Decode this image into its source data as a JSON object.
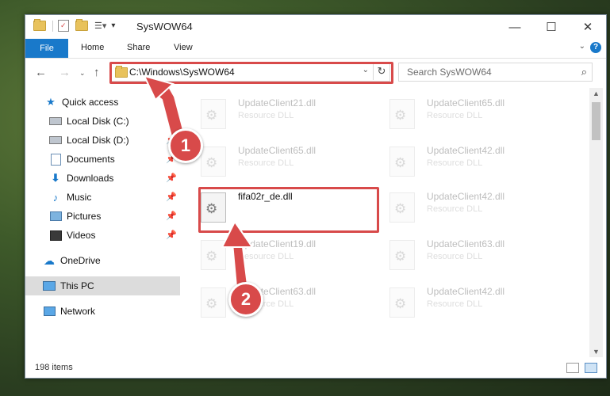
{
  "window": {
    "title": "SysWOW64",
    "minimize": "—",
    "maximize": "☐",
    "close": "✕"
  },
  "ribbon": {
    "tabs": [
      "File",
      "Home",
      "Share",
      "View"
    ],
    "help": "?"
  },
  "navbar": {
    "address": "C:\\Windows\\SysWOW64",
    "search_placeholder": "Search SysWOW64"
  },
  "sidebar": {
    "items": [
      {
        "label": "Quick access",
        "icon": "star-icon",
        "pinned": false
      },
      {
        "label": "Local Disk (C:)",
        "icon": "drive-icon",
        "pinned": false
      },
      {
        "label": "Local Disk (D:)",
        "icon": "drive-icon",
        "pinned": true
      },
      {
        "label": "Documents",
        "icon": "documents-icon",
        "pinned": true
      },
      {
        "label": "Downloads",
        "icon": "download-icon",
        "pinned": true
      },
      {
        "label": "Music",
        "icon": "music-icon",
        "pinned": true
      },
      {
        "label": "Pictures",
        "icon": "pictures-icon",
        "pinned": true
      },
      {
        "label": "Videos",
        "icon": "videos-icon",
        "pinned": true
      },
      {
        "label": "OneDrive",
        "icon": "cloud-icon",
        "pinned": false
      },
      {
        "label": "This PC",
        "icon": "computer-icon",
        "pinned": false,
        "selected": true
      },
      {
        "label": "Network",
        "icon": "network-icon",
        "pinned": false
      }
    ]
  },
  "files": {
    "left": [
      {
        "name": "UpdateClient21.dll",
        "type": "Resource DLL"
      },
      {
        "name": "UpdateClient65.dll",
        "type": "Resource DLL"
      },
      {
        "name": "fifa02r_de.dll",
        "type": ""
      },
      {
        "name": "UpdateClient19.dll",
        "type": "Resource DLL"
      },
      {
        "name": "UpdateClient63.dll",
        "type": "Resource DLL"
      }
    ],
    "right": [
      {
        "name": "UpdateClient65.dll",
        "type": "Resource DLL"
      },
      {
        "name": "UpdateClient42.dll",
        "type": "Resource DLL"
      },
      {
        "name": "UpdateClient42.dll",
        "type": "Resource DLL"
      },
      {
        "name": "UpdateClient63.dll",
        "type": "Resource DLL"
      },
      {
        "name": "UpdateClient42.dll",
        "type": "Resource DLL"
      }
    ]
  },
  "status": {
    "item_count": "198 items"
  },
  "annotations": {
    "step1": "1",
    "step2": "2",
    "color": "#d84a4a"
  }
}
